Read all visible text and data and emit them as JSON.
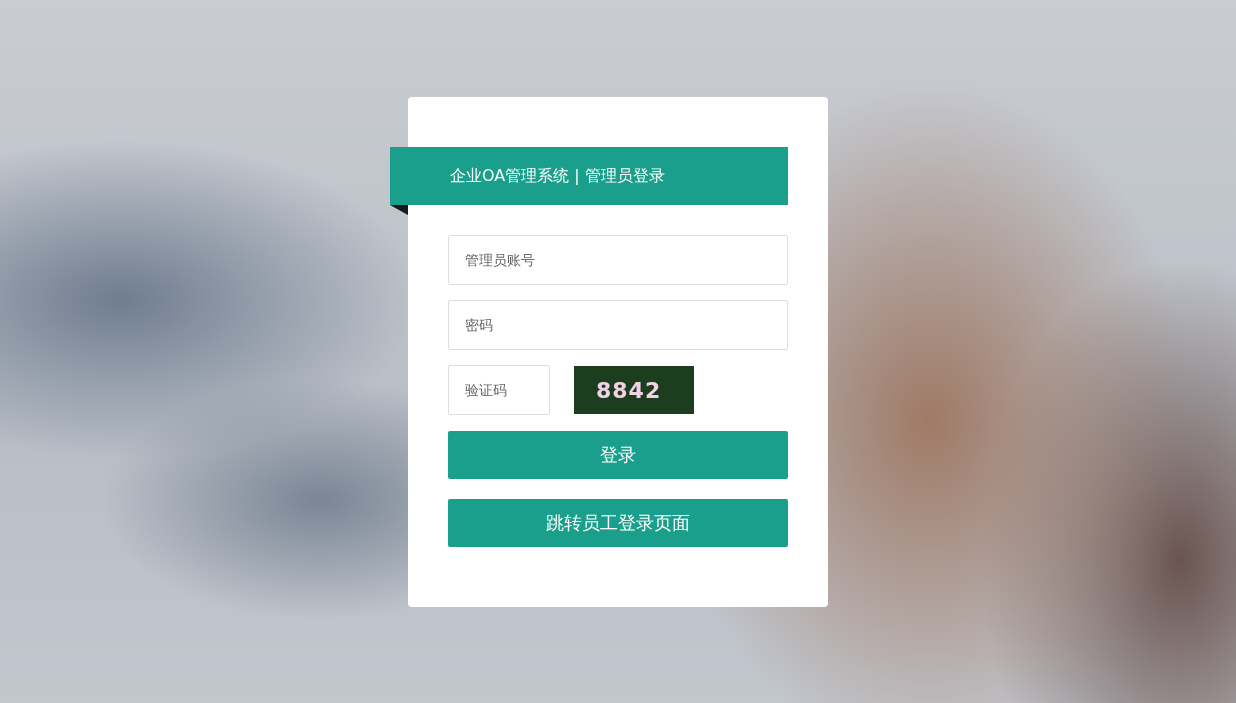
{
  "header": {
    "title": "企业OA管理系统 | 管理员登录"
  },
  "fields": [
    {
      "placeholder": "管理员账号"
    },
    {
      "placeholder": "密码"
    }
  ],
  "captcha": {
    "placeholder": "验证码",
    "code": "8842"
  },
  "buttons": [
    {
      "label": "登录"
    },
    {
      "label": "跳转员工登录页面"
    }
  ]
}
